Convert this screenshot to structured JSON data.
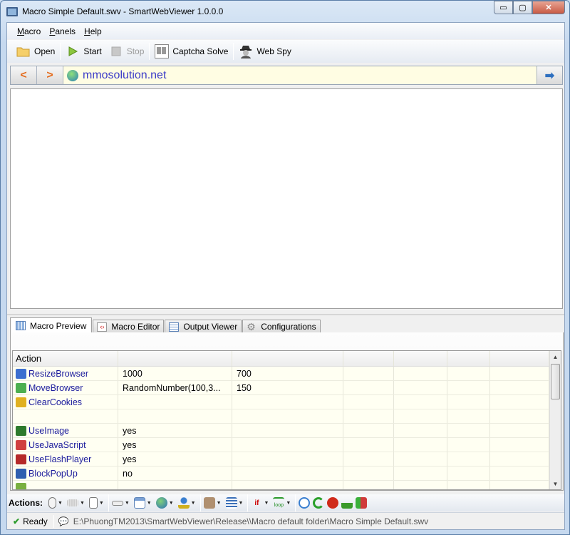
{
  "window": {
    "title": "Macro Simple Default.swv - SmartWebViewer 1.0.0.0",
    "min": "▭",
    "max": "▢",
    "close": "✕"
  },
  "menu": [
    "Macro",
    "Panels",
    "Help"
  ],
  "toolbar": {
    "open": "Open",
    "start": "Start",
    "stop": "Stop",
    "captcha": "Captcha Solve",
    "webspy": "Web Spy"
  },
  "address": {
    "back": "<",
    "forward": ">",
    "url": "mmosolution.net",
    "go": "➡"
  },
  "tabs": [
    "Macro Preview",
    "Macro Editor",
    "Output Viewer",
    "Configurations"
  ],
  "grid": {
    "header": "Action",
    "rows": [
      {
        "action": "ResizeBrowser",
        "p1": "1000",
        "p2": "700",
        "icon": "resize-icon",
        "color": "#3c6fd0"
      },
      {
        "action": "MoveBrowser",
        "p1": "RandomNumber(100,3...",
        "p2": "150",
        "icon": "move-icon",
        "color": "#4caf50"
      },
      {
        "action": "ClearCookies",
        "p1": "",
        "p2": "",
        "icon": "broom-icon",
        "color": "#e0b020"
      },
      {
        "action": "",
        "p1": "",
        "p2": "",
        "icon": "",
        "color": ""
      },
      {
        "action": "UseImage",
        "p1": "yes",
        "p2": "",
        "icon": "image-icon",
        "color": "#2d7a2d"
      },
      {
        "action": "UseJavaScript",
        "p1": "yes",
        "p2": "",
        "icon": "javascript-icon",
        "color": "#d04040"
      },
      {
        "action": "UseFlashPlayer",
        "p1": "yes",
        "p2": "",
        "icon": "flash-icon",
        "color": "#b52a2a"
      },
      {
        "action": "BlockPopUp",
        "p1": "no",
        "p2": "",
        "icon": "block-popup-icon",
        "color": "#2f5fb0"
      },
      {
        "action": "",
        "p1": "",
        "p2": "",
        "icon": "",
        "color": "#7ab040"
      }
    ]
  },
  "actions_label": "Actions:",
  "status": {
    "state": "Ready",
    "path": "E:\\PhuongTM2013\\SmartWebViewer\\Release\\\\Macro default folder\\Macro Simple Default.swv"
  }
}
